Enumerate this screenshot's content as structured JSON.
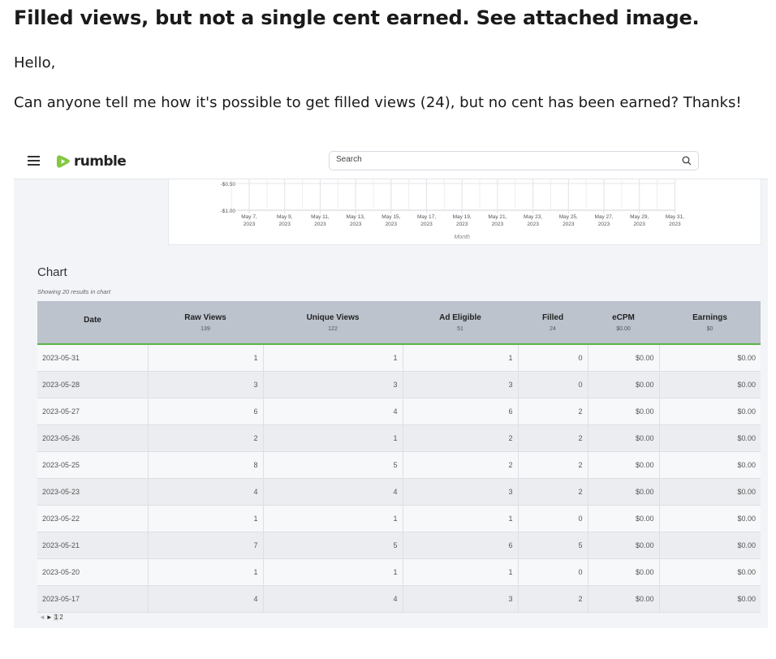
{
  "post": {
    "title": "Filled views, but not a single cent earned. See attached image.",
    "greeting": "Hello,",
    "body": "Can anyone tell me how it's possible to get filled views (24), but no cent has been earned? Thanks!"
  },
  "header": {
    "brand": "rumble",
    "search_placeholder": "Search",
    "icons": [
      "menu-icon",
      "rumble-logo-icon",
      "search-icon"
    ]
  },
  "graph": {
    "y_ticks": [
      "-$0.50",
      "-$1.00"
    ],
    "x_ticks": [
      [
        "May 7,",
        "2023"
      ],
      [
        "May 9,",
        "2023"
      ],
      [
        "May 11,",
        "2023"
      ],
      [
        "May 13,",
        "2023"
      ],
      [
        "May 15,",
        "2023"
      ],
      [
        "May 17,",
        "2023"
      ],
      [
        "May 19,",
        "2023"
      ],
      [
        "May 21,",
        "2023"
      ],
      [
        "May 23,",
        "2023"
      ],
      [
        "May 25,",
        "2023"
      ],
      [
        "May 27,",
        "2023"
      ],
      [
        "May 29,",
        "2023"
      ],
      [
        "May 31,",
        "2023"
      ]
    ],
    "x_label": "Month"
  },
  "chart": {
    "heading": "Chart",
    "subtitle": "Showing 20 results in chart",
    "columns": [
      {
        "label": "Date",
        "total": ""
      },
      {
        "label": "Raw Views",
        "total": "139"
      },
      {
        "label": "Unique Views",
        "total": "122"
      },
      {
        "label": "Ad Eligible",
        "total": "51"
      },
      {
        "label": "Filled",
        "total": "24"
      },
      {
        "label": "eCPM",
        "total": "$0.00"
      },
      {
        "label": "Earnings",
        "total": "$0"
      }
    ],
    "rows": [
      [
        "2023-05-31",
        "1",
        "1",
        "1",
        "0",
        "$0.00",
        "$0.00"
      ],
      [
        "2023-05-28",
        "3",
        "3",
        "3",
        "0",
        "$0.00",
        "$0.00"
      ],
      [
        "2023-05-27",
        "6",
        "4",
        "6",
        "2",
        "$0.00",
        "$0.00"
      ],
      [
        "2023-05-26",
        "2",
        "1",
        "2",
        "2",
        "$0.00",
        "$0.00"
      ],
      [
        "2023-05-25",
        "8",
        "5",
        "2",
        "2",
        "$0.00",
        "$0.00"
      ],
      [
        "2023-05-23",
        "4",
        "4",
        "3",
        "2",
        "$0.00",
        "$0.00"
      ],
      [
        "2023-05-22",
        "1",
        "1",
        "1",
        "0",
        "$0.00",
        "$0.00"
      ],
      [
        "2023-05-21",
        "7",
        "5",
        "6",
        "5",
        "$0.00",
        "$0.00"
      ],
      [
        "2023-05-20",
        "1",
        "1",
        "1",
        "0",
        "$0.00",
        "$0.00"
      ],
      [
        "2023-05-17",
        "4",
        "4",
        "3",
        "2",
        "$0.00",
        "$0.00"
      ]
    ]
  },
  "pager": {
    "prev": "◄",
    "next": "►",
    "pages": [
      "1",
      "2"
    ]
  }
}
